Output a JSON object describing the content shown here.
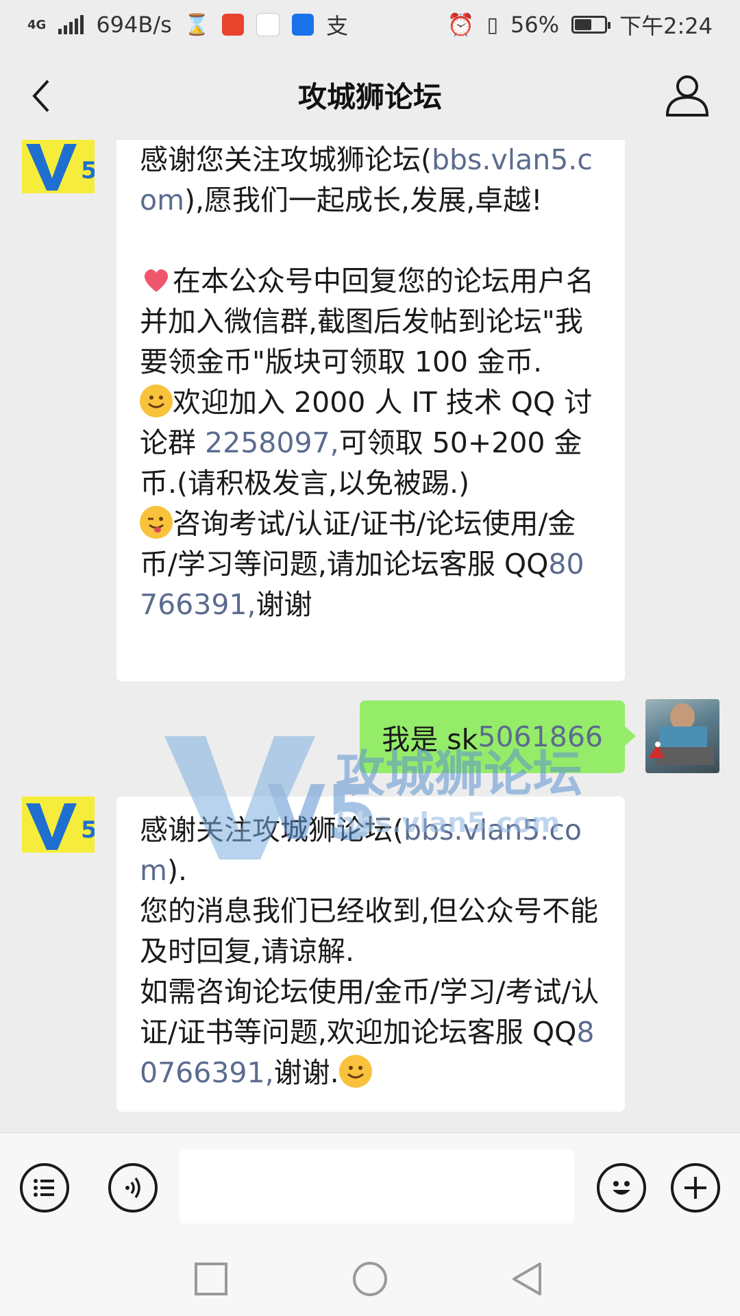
{
  "status_bar": {
    "network": "4G",
    "speed": "694B/s",
    "battery": "56%",
    "battery_level": 0.56,
    "time": "下午2:24"
  },
  "nav": {
    "title": "攻城狮论坛"
  },
  "messages": {
    "first": {
      "p1": "感谢您关注攻城狮论坛(",
      "p1_link": "bbs.vlan5.com",
      "p2": "),愿我们一起成长,发展,卓越!",
      "p3": "在本公众号中回复您的论坛用户名并加入微信群,截图后发帖到论坛\"我要领金币\"版块可领取 100 金币.",
      "p4": "欢迎加入 2000 人 IT 技术 QQ 讨论群 ",
      "p4_link": "2258097,",
      "p5": "可领取 50+200 金币.(请积极发言,以免被踢.)",
      "p6": "咨询考试/认证/证书/论坛使用/金币/学习等问题,请加论坛客服 QQ",
      "p6_link": "80766391,",
      "p7": "谢谢"
    },
    "outgoing": {
      "text": "我是 sk",
      "link": "5061866"
    },
    "second": {
      "p1": "感谢关注攻城狮论坛(",
      "p1_link": "bbs.vlan5.com",
      "p2": ").\n您的消息我们已经收到,但公众号不能及时回复,请谅解.\n如需咨询论坛使用/金币/学习/考试/认证/证书等问题,欢迎加论坛客服 QQ",
      "p2_link": "80766391,",
      "p3": "谢谢."
    }
  },
  "watermark": {
    "logo": "V5",
    "name": "攻城狮论坛",
    "url": "bbs.vlan5.com"
  },
  "colors": {
    "background": "#ededed",
    "incoming_bubble": "#ffffff",
    "outgoing_bubble": "#95ec69",
    "link": "#5b6b8e",
    "logo_bg": "#f6ec3b",
    "logo_fg": "#1f6fd1"
  },
  "icons": {
    "back": "chevron-left-icon",
    "profile": "person-icon",
    "menu": "list-icon",
    "voice": "voice-icon",
    "emoji": "smiley-icon",
    "add": "plus-icon"
  }
}
